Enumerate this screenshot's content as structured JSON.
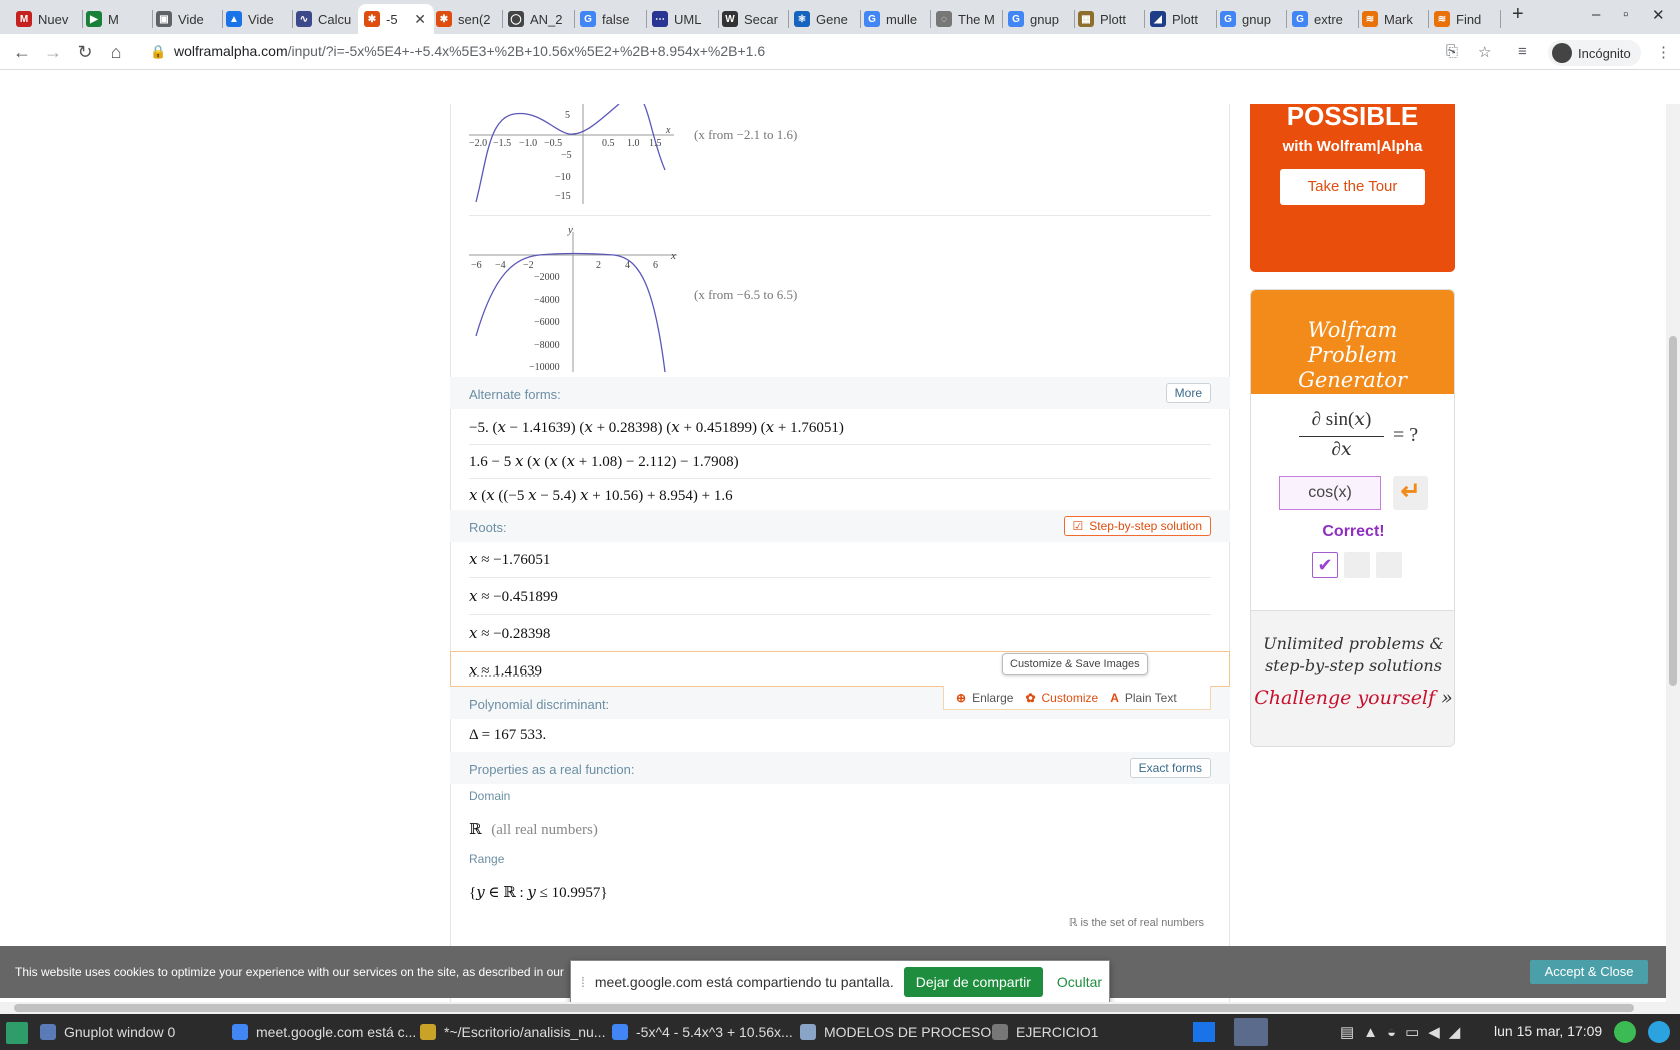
{
  "browser": {
    "tabs": [
      {
        "label": "Nuev",
        "color": "#c5221f",
        "glyph": "M"
      },
      {
        "label": "M",
        "color": "#188038",
        "glyph": "▶"
      },
      {
        "label": "Vide",
        "color": "#5f6368",
        "glyph": "▣"
      },
      {
        "label": "Vide",
        "color": "#1a73e8",
        "glyph": "▲"
      },
      {
        "label": "Calcu",
        "color": "#3c4a8a",
        "glyph": "∿"
      },
      {
        "label": "-5",
        "color": "#dd4e10",
        "glyph": "✱",
        "active": true
      },
      {
        "label": "sen(2",
        "color": "#dd4e10",
        "glyph": "✱"
      },
      {
        "label": "AN_2",
        "color": "#444444",
        "glyph": "◯"
      },
      {
        "label": "false",
        "color": "#4285f4",
        "glyph": "G"
      },
      {
        "label": "UML",
        "color": "#283593",
        "glyph": "⋯"
      },
      {
        "label": "Secar",
        "color": "#333333",
        "glyph": "W"
      },
      {
        "label": "Gene",
        "color": "#1565c0",
        "glyph": "⚛"
      },
      {
        "label": "mulle",
        "color": "#4285f4",
        "glyph": "G"
      },
      {
        "label": "The M",
        "color": "#777777",
        "glyph": "◌"
      },
      {
        "label": "gnup",
        "color": "#4285f4",
        "glyph": "G"
      },
      {
        "label": "Plott",
        "color": "#8d6e2c",
        "glyph": "▦"
      },
      {
        "label": "Plott",
        "color": "#1f3c88",
        "glyph": "◢"
      },
      {
        "label": "gnup",
        "color": "#4285f4",
        "glyph": "G"
      },
      {
        "label": "extre",
        "color": "#4285f4",
        "glyph": "G"
      },
      {
        "label": "Mark",
        "color": "#e8710a",
        "glyph": "≋"
      },
      {
        "label": "Find",
        "color": "#e8710a",
        "glyph": "≋"
      }
    ],
    "url_host": "wolframalpha.com",
    "url_path": "/input/?i=-5x%5E4+-+5.4x%5E3+%2B+10.56x%5E2+%2B+8.954x+%2B+1.6",
    "incognito_label": "Incógnito"
  },
  "plots": {
    "plot1_range": "(x from −2.1 to 1.6)",
    "plot2_range": "(x from −6.5 to 6.5)"
  },
  "alternate": {
    "title": "Alternate forms:",
    "more": "More",
    "forms": [
      "−5. (𝑥 − 1.41639) (𝑥 + 0.28398) (𝑥 + 0.451899) (𝑥 + 1.76051)",
      "1.6 − 5 𝑥 (𝑥 (𝑥 (𝑥 + 1.08) − 2.112) − 1.7908)",
      "𝑥 (𝑥 ((−5 𝑥 − 5.4) 𝑥 + 10.56) + 8.954) + 1.6"
    ]
  },
  "roots": {
    "title": "Roots:",
    "step_button": "Step-by-step solution",
    "values": [
      "𝑥 ≈ −1.76051",
      "𝑥 ≈ −0.451899",
      "𝑥 ≈ −0.28398",
      "𝑥 ≈ 1.41639"
    ]
  },
  "hover": {
    "tooltip": "Customize & Save Images",
    "enlarge": "Enlarge",
    "customize": "Customize",
    "plain_text": "Plain Text"
  },
  "discriminant": {
    "title": "Polynomial discriminant:",
    "value": "Δ = 167 533."
  },
  "properties": {
    "title": "Properties as a real function:",
    "exact_forms": "Exact forms",
    "domain_label": "Domain",
    "domain_value": "ℝ",
    "domain_note": "(all real numbers)",
    "range_label": "Range",
    "range_value": "{𝑦 ∈ ℝ : 𝑦 ≤ 10.9957}",
    "footnote": "ℝ is the set of real numbers"
  },
  "ads": {
    "possible": "POSSIBLE",
    "with": "with Wolfram|Alpha",
    "tour": "Take the Tour",
    "gen_title": "Wolfram Problem Generator",
    "numerator": "∂ sin(𝑥)",
    "denominator": "∂𝑥",
    "equals": "= ?",
    "answer": "cos(x)",
    "correct": "Correct!",
    "unlimited": "Unlimited problems & step-by-step solutions",
    "challenge": "Challenge yourself",
    "chevrons": "»"
  },
  "cookie": {
    "text": "This website uses cookies to optimize your experience with our services on the site, as described in our",
    "accept": "Accept & Close"
  },
  "share": {
    "text": "meet.google.com está compartiendo tu pantalla.",
    "stop": "Dejar de compartir",
    "hide": "Ocultar"
  },
  "taskbar": {
    "items": [
      {
        "label": "Gnuplot window 0",
        "color": "#5a7ab8"
      },
      {
        "label": "meet.google.com está c...",
        "color": "#4285f4"
      },
      {
        "label": "*~/Escritorio/analisis_nu...",
        "color": "#c9a227"
      },
      {
        "label": "-5x^4 - 5.4x^3 + 10.56x...",
        "color": "#4285f4"
      },
      {
        "label": "MODELOS DE PROCESO...",
        "color": "#8aa4c8"
      },
      {
        "label": "EJERCICIO1",
        "color": "#777777"
      }
    ],
    "clock": "lun 15 mar, 17:09"
  }
}
